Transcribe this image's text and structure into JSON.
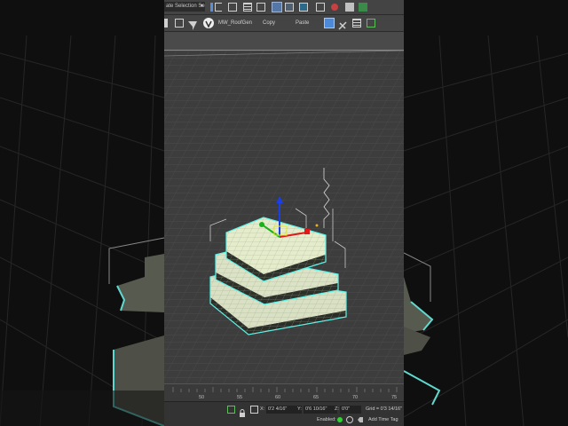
{
  "toolbar": {
    "selection_set_label": "ate Selection Se",
    "script_label": "MW_RoofGen",
    "copy_label": "Copy",
    "paste_label": "Paste"
  },
  "timeline": {
    "ticks": [
      "50",
      "55",
      "60",
      "65",
      "70",
      "75"
    ]
  },
  "status": {
    "x_label": "X:",
    "x_value": "0'2 4/16\"",
    "y_label": "Y:",
    "y_value": "0'6 10/16\"",
    "z_label": "Z:",
    "z_value": "0'0\"",
    "grid_text": "Grid = 0'3 14/16\"",
    "enabled_label": "Enabled:",
    "add_time_tag_label": "Add Time Tag"
  },
  "colors": {
    "selection_outline": "#5ff2e6",
    "geometry_fill": "#e4eccc",
    "gizmo_x": "#e01818",
    "gizmo_y": "#19b319",
    "gizmo_z": "#1b3fe6",
    "gizmo_plane": "#e8e820"
  }
}
